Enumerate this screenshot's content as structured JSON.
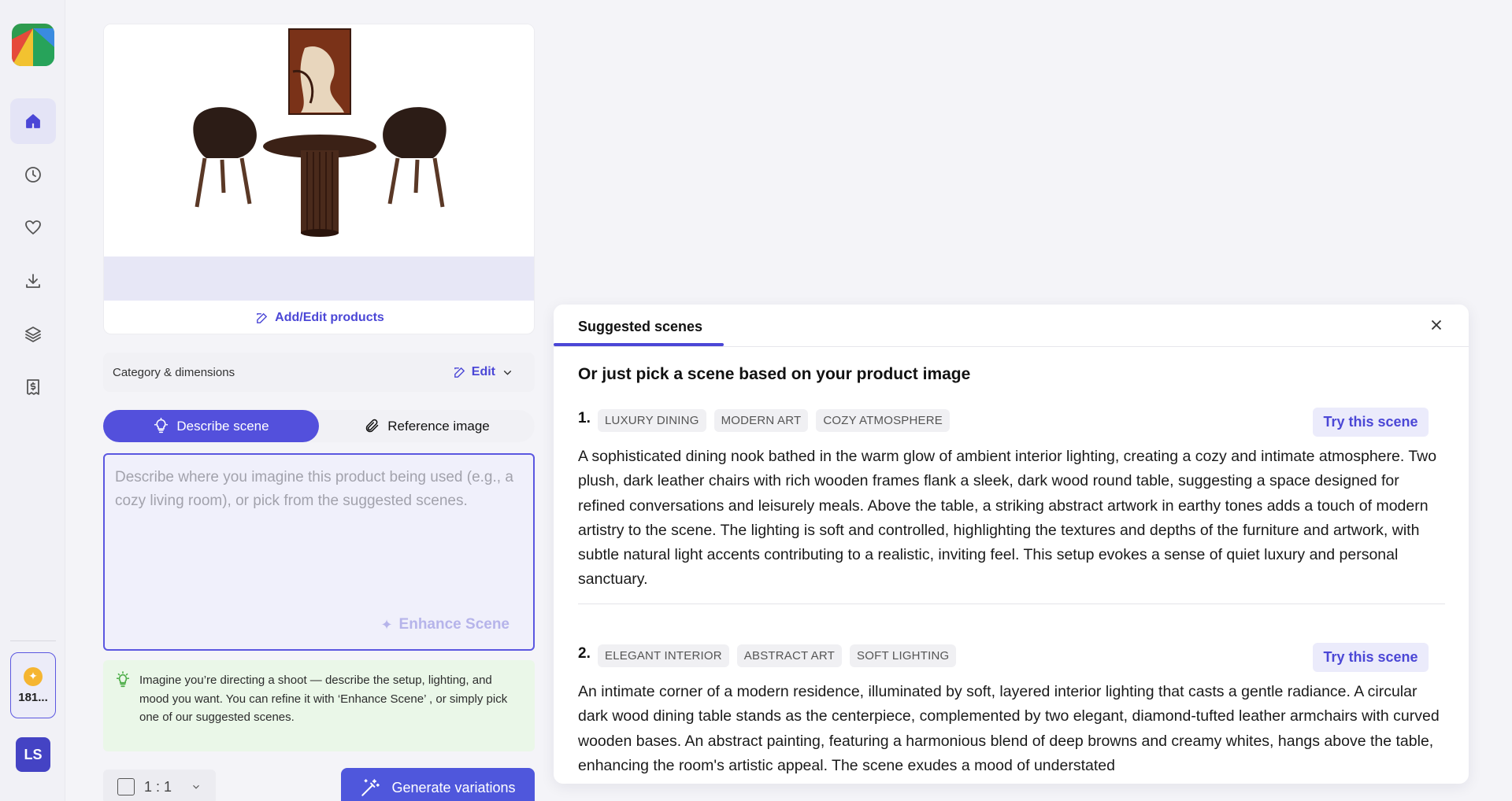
{
  "sidebar": {
    "nav": [
      {
        "icon": "home-icon"
      },
      {
        "icon": "history-clock-icon"
      },
      {
        "icon": "heart-icon"
      },
      {
        "icon": "download-icon"
      },
      {
        "icon": "layers-icon"
      },
      {
        "icon": "billing-receipt-icon"
      }
    ],
    "credits_value": "181...",
    "avatar_initials": "LS"
  },
  "product": {
    "add_edit_label": "Add/Edit products"
  },
  "category": {
    "label": "Category & dimensions",
    "edit_label": "Edit"
  },
  "mode": {
    "describe_label": "Describe scene",
    "reference_label": "Reference image"
  },
  "scene_input": {
    "placeholder": "Describe where you imagine this product being used (e.g., a cozy living room), or pick from the suggested scenes.",
    "value": "",
    "enhance_label": "Enhance Scene"
  },
  "tip": {
    "text": "Imagine you’re directing a shoot — describe the setup, lighting, and mood you want. You can refine it with ‘Enhance Scene’ , or simply pick one of our suggested scenes."
  },
  "ratio": {
    "value": "1 : 1"
  },
  "generate_label": "Generate variations",
  "suggested": {
    "tab_label": "Suggested scenes",
    "heading": "Or just pick a scene based on your product image",
    "try_label": "Try this scene",
    "scenes": [
      {
        "number": "1.",
        "tags": [
          "LUXURY DINING",
          "MODERN ART",
          "COZY ATMOSPHERE"
        ],
        "description": "A sophisticated dining nook bathed in the warm glow of ambient interior lighting, creating a cozy and intimate atmosphere. Two plush, dark leather chairs with rich wooden frames flank a sleek, dark wood round table, suggesting a space designed for refined conversations and leisurely meals. Above the table, a striking abstract artwork in earthy tones adds a touch of modern artistry to the scene. The lighting is soft and controlled, highlighting the textures and depths of the furniture and artwork, with subtle natural light accents contributing to a realistic, inviting feel. This setup evokes a sense of quiet luxury and personal sanctuary."
      },
      {
        "number": "2.",
        "tags": [
          "ELEGANT INTERIOR",
          "ABSTRACT ART",
          "SOFT LIGHTING"
        ],
        "description": "An intimate corner of a modern residence, illuminated by soft, layered interior lighting that casts a gentle radiance. A circular dark wood dining table stands as the centerpiece, complemented by two elegant, diamond-tufted leather armchairs with curved wooden bases. An abstract painting, featuring a harmonious blend of deep browns and creamy whites, hangs above the table, enhancing the room's artistic appeal. The scene exudes a mood of understated"
      }
    ]
  },
  "colors": {
    "accent": "#4b47d6",
    "accent_button": "#5350dc",
    "tip_bg": "#eaf7e8"
  }
}
